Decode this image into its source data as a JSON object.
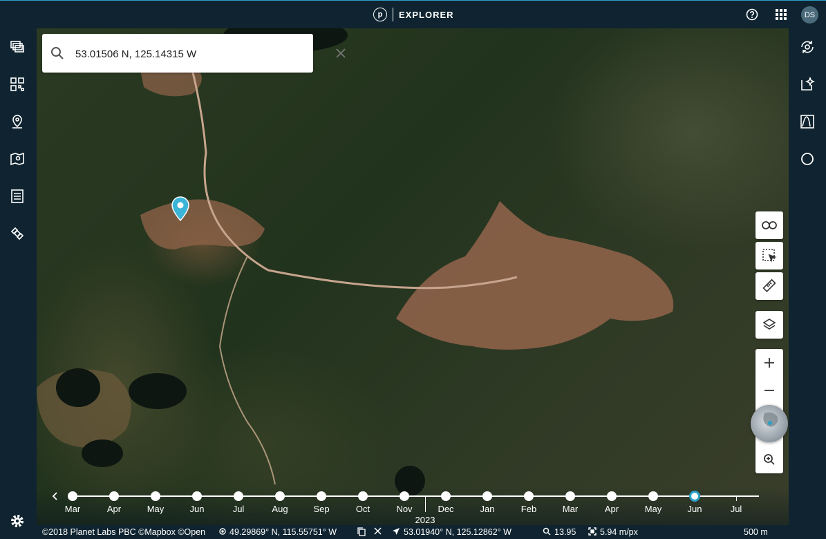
{
  "app": {
    "title": "EXPLORER",
    "logo_letter": "p",
    "user_initials": "DS"
  },
  "colors": {
    "accent": "#2aa0c8",
    "chrome": "#0f2430",
    "marker": "#3bb4d8"
  },
  "top_icons": [
    "help-icon",
    "apps-grid-icon"
  ],
  "left_sidebar": [
    "layers-stack-icon",
    "qr-grid-icon",
    "location-pin-icon",
    "map-pin-icon",
    "list-document-icon",
    "satellite-icon",
    "settings-icon"
  ],
  "right_sidebar": [
    "refresh-cycle-icon",
    "sparkle-image-icon",
    "spectrum-chart-icon",
    "contrast-icon"
  ],
  "search": {
    "value": "53.01506 N, 125.14315 W",
    "placeholder": "Search"
  },
  "map_tools": [
    "link-icon",
    "select-area-icon",
    "ruler-icon",
    "layers-icon"
  ],
  "zoom": {
    "in": "+",
    "out": "–"
  },
  "timeline": {
    "months": [
      "Mar",
      "Apr",
      "May",
      "Jun",
      "Jul",
      "Aug",
      "Sep",
      "Oct",
      "Nov",
      "Dec",
      "Jan",
      "Feb",
      "Mar",
      "Apr",
      "May",
      "Jun",
      "Jul"
    ],
    "year": "2023",
    "selected": "Jun"
  },
  "status": {
    "attribution": "©2018 Planet Labs PBC ©Mapbox ©Open",
    "cursor_coords": "49.29869° N, 115.55751° W",
    "center_coords": "53.01940° N, 125.12862° W",
    "zoom_level": "13.95",
    "resolution": "5.94 m/px",
    "scale": "500 m"
  }
}
